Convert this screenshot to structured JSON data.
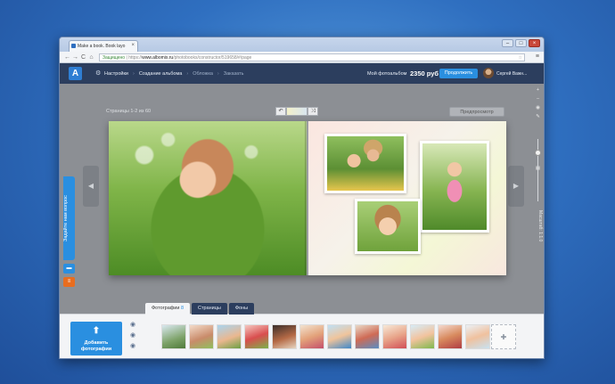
{
  "browser": {
    "tab_title": "Make a book. Book layo",
    "tab_close": "×",
    "win_min": "–",
    "win_max": "□",
    "win_close": "×",
    "back": "←",
    "forward": "→",
    "reload": "C",
    "home": "⌂",
    "address_secure": "Защищено",
    "address_scheme": "https://",
    "address_host": "www.albomix.ru",
    "address_path": "/photobooks/constructor/519658/#/page",
    "star": "☆",
    "menu": "≡"
  },
  "appbar": {
    "logo": "A",
    "settings_icon": "⚙",
    "settings_label": "Настройки",
    "sep": "›",
    "crumb_create": "Создание альбома",
    "crumb_cover": "Обложка",
    "crumb_order": "Заказать",
    "my_album": "Мой фотоальбом",
    "price": "2350 руб",
    "continue_button": "Продолжить",
    "user_name": "Сергей Важн..."
  },
  "editor": {
    "pages_label": "Страницы 1-2 из 60",
    "undo": "↶",
    "shuffle": "⤨",
    "preview_button": "Предпросмотр",
    "arrow_left": "◀",
    "arrow_right": "▶",
    "support_tab": "Задайте нам вопрос",
    "zoom_label": "Масштаб: 1:1.0",
    "tools": {
      "layout": "▦",
      "text": "T",
      "crown": "♛"
    },
    "side_icons": {
      "rate": "★",
      "chat": "▬",
      "orange": "≡"
    },
    "rail_icons": {
      "zoom_in": "+",
      "zoom_out": "–",
      "eye": "◉",
      "pin": "✎"
    }
  },
  "bottom": {
    "tab_photos": "Фотографии",
    "tab_photos_count": "8",
    "tab_pages": "Страницы",
    "tab_backgrounds": "Фоны",
    "add_photos_line1": "Добавить",
    "add_photos_line2": "фотографии",
    "add_photos_icon": "⬆",
    "eye_icon": "◉",
    "add_slot_icon": "✚"
  },
  "colors": {
    "accent": "#2a8fe0",
    "appbar": "#2c3e5e",
    "editor_bg": "#8c8f94"
  }
}
